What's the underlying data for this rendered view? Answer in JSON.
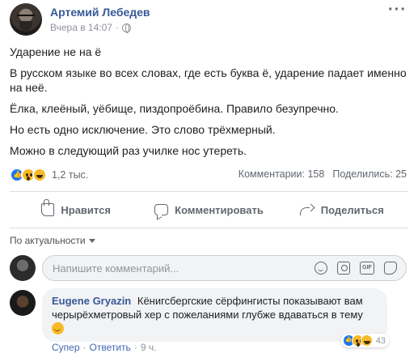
{
  "post": {
    "author": "Артемий Лебедев",
    "timestamp": "Вчера в 14:07",
    "separator": "·",
    "more_icon": "more-icon",
    "paragraphs": [
      "Ударение не на ё",
      "В русском языке во всех словах, где есть буква ё, ударение падает именно на неё.",
      "Ёлка, клеёный, уёбище, пиздопроёбина. Правило безупречно.",
      "Но есть одно исключение. Это слово трёхмерный.",
      "Можно в следующий раз училке нос утереть."
    ],
    "reactions_count": "1,2 тыс.",
    "comments_count": "Комментарии: 158",
    "shares_count": "Поделились: 25"
  },
  "actions": {
    "like": "Нравится",
    "comment": "Комментировать",
    "share": "Поделиться"
  },
  "sort": {
    "label": "По актуальности"
  },
  "composer": {
    "placeholder": "Напишите комментарий...",
    "gif_label": "GIF"
  },
  "comment": {
    "author": "Eugene Gryazin",
    "text": "Кёнигсбергские сёрфингисты показывают вам черырёхметровый хер с пожеланиями глубже вдаваться в тему",
    "reactions_count": "43",
    "like_label": "Супер",
    "reply_label": "Ответить",
    "separator": "·",
    "time": "9 ч."
  },
  "colors": {
    "link": "#385898",
    "secondary_text": "#90949c",
    "like_blue": "#1877f2",
    "emoji_yellow": "#f7b928"
  }
}
